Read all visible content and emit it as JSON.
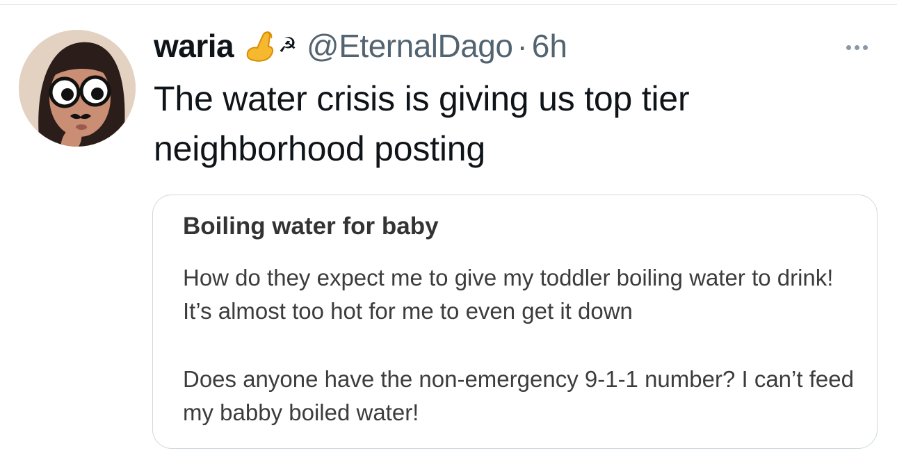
{
  "tweet": {
    "author": {
      "display_name": "waria",
      "badge_icons": [
        "pinched-fingers-emoji",
        "hammer-sickle-icon"
      ],
      "handle": "@EternalDago",
      "separator": "·",
      "timestamp": "6h"
    },
    "text_lines": [
      "The water crisis is giving us top tier",
      "neighborhood posting"
    ]
  },
  "quoted_post": {
    "title": "Boiling water for baby",
    "paragraphs": [
      "How do they expect me to give my toddler boiling water to drink! It’s almost too hot for me to even get it down",
      "Does anyone have the non-emergency 9-1-1 number? I can’t feed my babby boiled water!"
    ]
  },
  "colors": {
    "text_primary": "#0f1419",
    "text_secondary": "#536471",
    "card_border": "#cfd9de"
  }
}
